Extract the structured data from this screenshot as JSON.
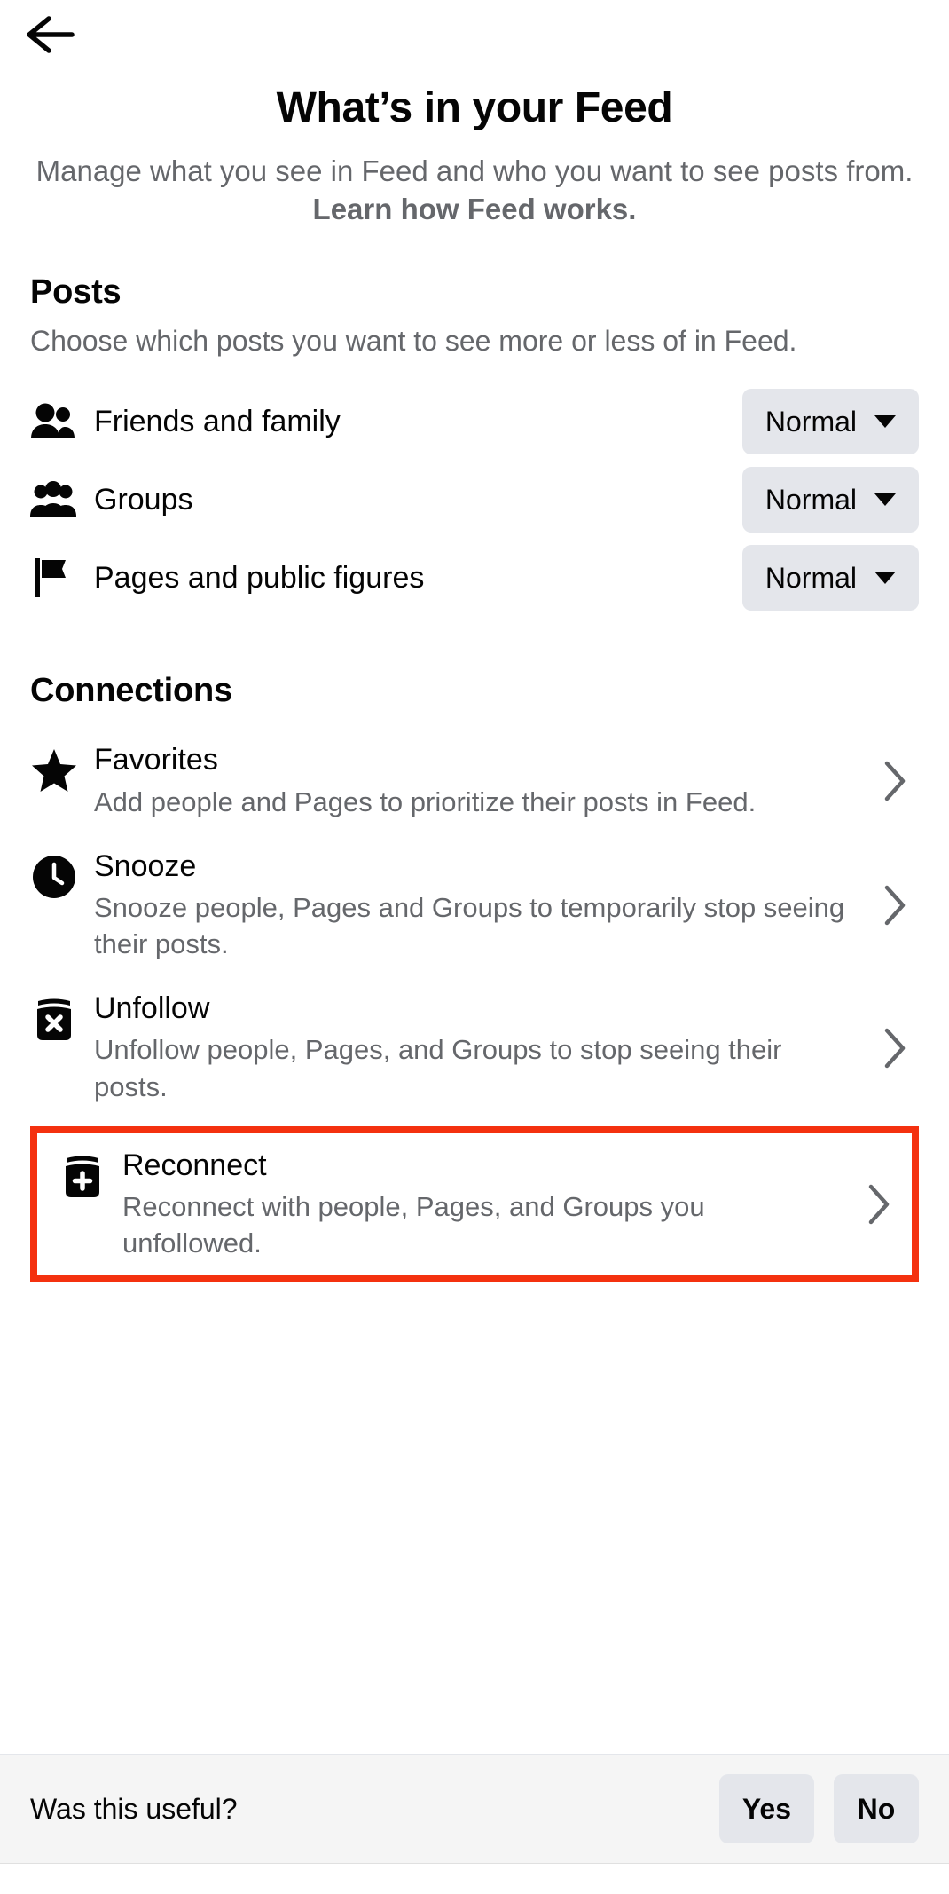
{
  "topbar": {
    "back_icon": "arrow-left-icon"
  },
  "header": {
    "title": "What’s in your Feed",
    "subtitle_plain": "Manage what you see in Feed and who you want to see posts from. ",
    "subtitle_link": "Learn how Feed works."
  },
  "posts": {
    "section_title": "Posts",
    "section_desc": "Choose which posts you want to see more or less of in Feed.",
    "rows": [
      {
        "icon": "friends-icon",
        "label": "Friends and family",
        "value": "Normal"
      },
      {
        "icon": "groups-icon",
        "label": "Groups",
        "value": "Normal"
      },
      {
        "icon": "flag-icon",
        "label": "Pages and public figures",
        "value": "Normal"
      }
    ]
  },
  "connections": {
    "section_title": "Connections",
    "rows": [
      {
        "icon": "star-icon",
        "title": "Favorites",
        "desc": "Add people and Pages to prioritize their posts in Feed.",
        "chevron": "chevron-right-icon",
        "highlighted": false
      },
      {
        "icon": "clock-icon",
        "title": "Snooze",
        "desc": "Snooze people, Pages and Groups to temporarily stop seeing their posts.",
        "chevron": "chevron-right-icon",
        "highlighted": false
      },
      {
        "icon": "unfollow-icon",
        "title": "Unfollow",
        "desc": "Unfollow people, Pages, and Groups to stop seeing their posts.",
        "chevron": "chevron-right-icon",
        "highlighted": false
      },
      {
        "icon": "reconnect-icon",
        "title": "Reconnect",
        "desc": "Reconnect with people, Pages, and Groups you unfollowed.",
        "chevron": "chevron-right-icon",
        "highlighted": true
      }
    ]
  },
  "footer": {
    "question": "Was this useful?",
    "yes_label": "Yes",
    "no_label": "No"
  },
  "colors": {
    "text_primary": "#050505",
    "text_secondary": "#65676b",
    "pill_bg": "#e4e6eb",
    "highlight_border": "#f4310f",
    "footer_bg": "#f5f5f5"
  }
}
